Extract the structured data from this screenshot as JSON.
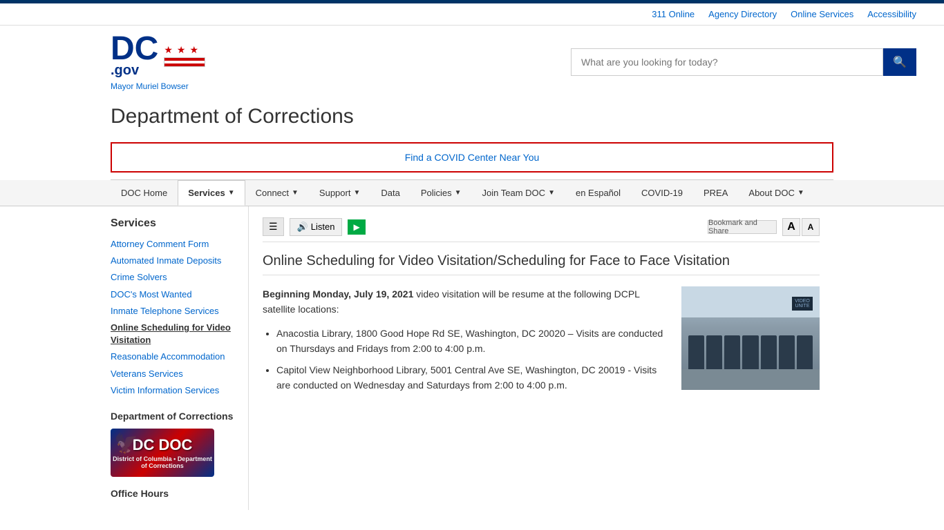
{
  "topBar": {},
  "topLinks": [
    {
      "label": "311 Online",
      "id": "311-online"
    },
    {
      "label": "Agency Directory",
      "id": "agency-directory"
    },
    {
      "label": "Online Services",
      "id": "online-services"
    },
    {
      "label": "Accessibility",
      "id": "accessibility"
    }
  ],
  "header": {
    "logoText": "DC",
    "logoSuffix": ".gov",
    "starCount": 3,
    "mayorLink": "Mayor Muriel Bowser",
    "searchPlaceholder": "What are you looking for today?"
  },
  "pageTitle": "Department of Corrections",
  "covidBanner": {
    "text": "Find a COVID Center Near You"
  },
  "nav": {
    "items": [
      {
        "label": "DOC Home",
        "id": "doc-home",
        "active": false,
        "hasArrow": false
      },
      {
        "label": "Services",
        "id": "services",
        "active": true,
        "hasArrow": true
      },
      {
        "label": "Connect",
        "id": "connect",
        "active": false,
        "hasArrow": true
      },
      {
        "label": "Support",
        "id": "support",
        "active": false,
        "hasArrow": true
      },
      {
        "label": "Data",
        "id": "data",
        "active": false,
        "hasArrow": false
      },
      {
        "label": "Policies",
        "id": "policies",
        "active": false,
        "hasArrow": true
      },
      {
        "label": "Join Team DOC",
        "id": "join-team-doc",
        "active": false,
        "hasArrow": true
      },
      {
        "label": "en Español",
        "id": "en-espanol",
        "active": false,
        "hasArrow": false
      },
      {
        "label": "COVID-19",
        "id": "covid-19",
        "active": false,
        "hasArrow": false
      },
      {
        "label": "PREA",
        "id": "prea",
        "active": false,
        "hasArrow": false
      },
      {
        "label": "About DOC",
        "id": "about-doc",
        "active": false,
        "hasArrow": true
      }
    ]
  },
  "sidebar": {
    "title": "Services",
    "links": [
      {
        "label": "Attorney Comment Form",
        "id": "attorney-comment-form",
        "active": false
      },
      {
        "label": "Automated Inmate Deposits",
        "id": "automated-inmate-deposits",
        "active": false
      },
      {
        "label": "Crime Solvers",
        "id": "crime-solvers",
        "active": false
      },
      {
        "label": "DOC's Most Wanted",
        "id": "docs-most-wanted",
        "active": false
      },
      {
        "label": "Inmate Telephone Services",
        "id": "inmate-telephone-services",
        "active": false
      },
      {
        "label": "Online Scheduling for Video Visitation",
        "id": "online-scheduling",
        "active": true
      },
      {
        "label": "Reasonable Accommodation",
        "id": "reasonable-accommodation",
        "active": false
      },
      {
        "label": "Veterans Services",
        "id": "veterans-services",
        "active": false
      },
      {
        "label": "Victim Information Services",
        "id": "victim-information-services",
        "active": false
      }
    ],
    "sectionTitle": "Department of Corrections",
    "docLogoText": "DC DOC",
    "docLogoSub": "District of Columbia • Department of Corrections"
  },
  "toolbar": {
    "listenLabel": "Listen",
    "bookmarkLabel": "Bookmark and Share",
    "fontLargeLabel": "A",
    "fontSmallLabel": "A"
  },
  "article": {
    "title": "Online Scheduling for Video Visitation/Scheduling for Face to Face Visitation",
    "intro": "Beginning Monday, July 19, 2021",
    "introRest": " video visitation will be resume at the following DCPL satellite locations:",
    "locations": [
      "Anacostia Library, 1800 Good Hope Rd SE, Washington, DC 20020 – Visits are conducted on Thursdays and Fridays from 2:00 to 4:00 p.m.",
      "Capitol View Neighborhood Library, 5001 Central Ave SE, Washington, DC 20019 - Visits are conducted on Wednesday and Saturdays from 2:00 to 4:00 p.m."
    ],
    "imageAlt": "Video visitation room",
    "imageSignText": "VIDEO UNITE"
  },
  "officeHours": {
    "label": "Office Hours"
  }
}
